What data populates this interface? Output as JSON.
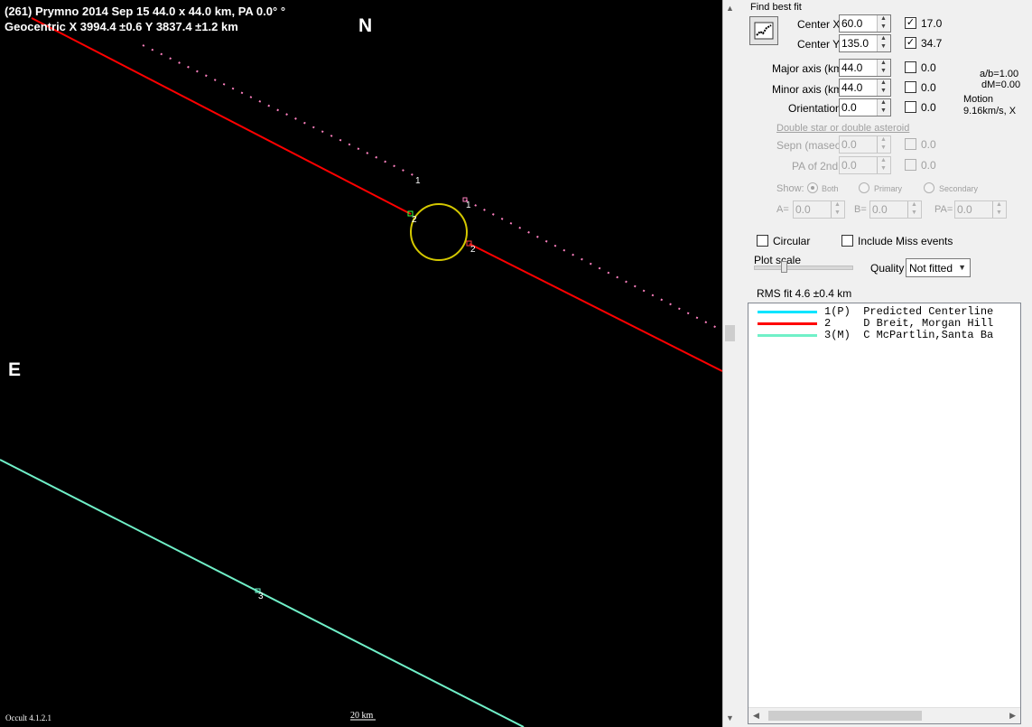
{
  "plot": {
    "header_line1": "(261) Prymno  2014 Sep 15   44.0 x 44.0 km,  PA 0.0° °",
    "header_line2": "Geocentric  X  3994.4 ±0.6  Y 3837.4 ±1.2 km",
    "north": "N",
    "east": "E",
    "version": "Occult 4.1.2.1",
    "scale": "20 km",
    "chord_labels": {
      "red_top_dot": "1",
      "red_top_dot2": "1",
      "red_disap": "2",
      "red_reap": "2",
      "cyan": "3"
    },
    "colors": {
      "background": "#000000",
      "ellipse": "#d4c800",
      "red_chord": "#ff0000",
      "cyan_chord": "#70f0c8",
      "dotted": "#ff80c0"
    }
  },
  "panel": {
    "find_best_fit": "Find best fit",
    "center_x": {
      "label": "Center X",
      "value": "60.0",
      "checked": true,
      "fit": "17.0"
    },
    "center_y": {
      "label": "Center Y",
      "value": "135.0",
      "checked": true,
      "fit": "34.7"
    },
    "major_axis": {
      "label": "Major axis (km)",
      "value": "44.0",
      "checked": false,
      "fit": "0.0"
    },
    "minor_axis": {
      "label": "Minor axis (km)",
      "value": "44.0",
      "checked": false,
      "fit": "0.0"
    },
    "orientation": {
      "label": "Orientation",
      "value": "0.0",
      "checked": false,
      "fit": "0.0"
    },
    "ab_ratio": "a/b=1.00",
    "dm": "dM=0.00",
    "motion_label": "Motion",
    "motion_value": "9.16km/s, X",
    "double_star": "Double star  or  double asteroid",
    "sepn": {
      "label": "Sepn (masec)",
      "value": "0.0",
      "fit": "0.0"
    },
    "pa2": {
      "label": "PA of 2nd",
      "value": "0.0",
      "fit": "0.0"
    },
    "show_label": "Show:",
    "show_options": [
      "Both",
      "Primary",
      "Secondary"
    ],
    "a_label": "A=",
    "a_value": "0.0",
    "b_label": "B=",
    "b_value": "0.0",
    "pa_label": "PA=",
    "pa_value": "0.0",
    "circular": "Circular",
    "include_miss": "Include Miss events",
    "plot_scale": "Plot scale",
    "quality_label": "Quality",
    "quality_value": "Not fitted",
    "rms_fit": "RMS fit  4.6 ±0.4 km"
  },
  "legend": [
    {
      "color": "#00e5ff",
      "text": "1(P)  Predicted Centerline"
    },
    {
      "color": "#ff0000",
      "text": "2     D Breit, Morgan Hill"
    },
    {
      "color": "#70f0c8",
      "text": "3(M)  C McPartlin,Santa Ba"
    }
  ]
}
